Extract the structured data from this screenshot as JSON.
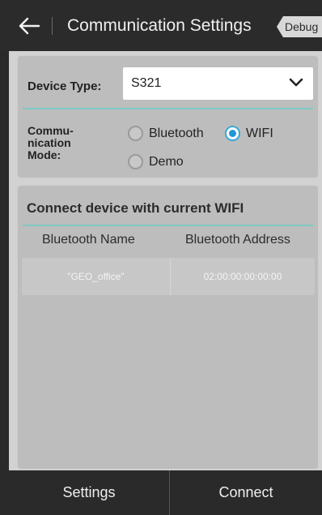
{
  "header": {
    "title": "Communication Settings",
    "debug_tab": "Debug"
  },
  "device_type": {
    "label": "Device Type:",
    "value": "S321"
  },
  "communication_mode": {
    "label_line1": "Commu-",
    "label_line2": "nication",
    "label_line3": "Mode:",
    "options": [
      {
        "label": "Bluetooth",
        "checked": false
      },
      {
        "label": "WIFI",
        "checked": true
      },
      {
        "label": "Demo",
        "checked": false
      }
    ]
  },
  "devices": {
    "section_title": "Connect device with current WIFI",
    "columns": [
      "Bluetooth Name",
      "Bluetooth Address"
    ],
    "rows": [
      {
        "name": "\"GEO_office\"",
        "address": "02:00:00:00:00:00"
      }
    ]
  },
  "bottom_bar": {
    "settings_label": "Settings",
    "connect_label": "Connect"
  },
  "colors": {
    "accent": "#2196d8",
    "divider_teal": "#7ec9c3",
    "header_bg": "#2b2b2b"
  }
}
